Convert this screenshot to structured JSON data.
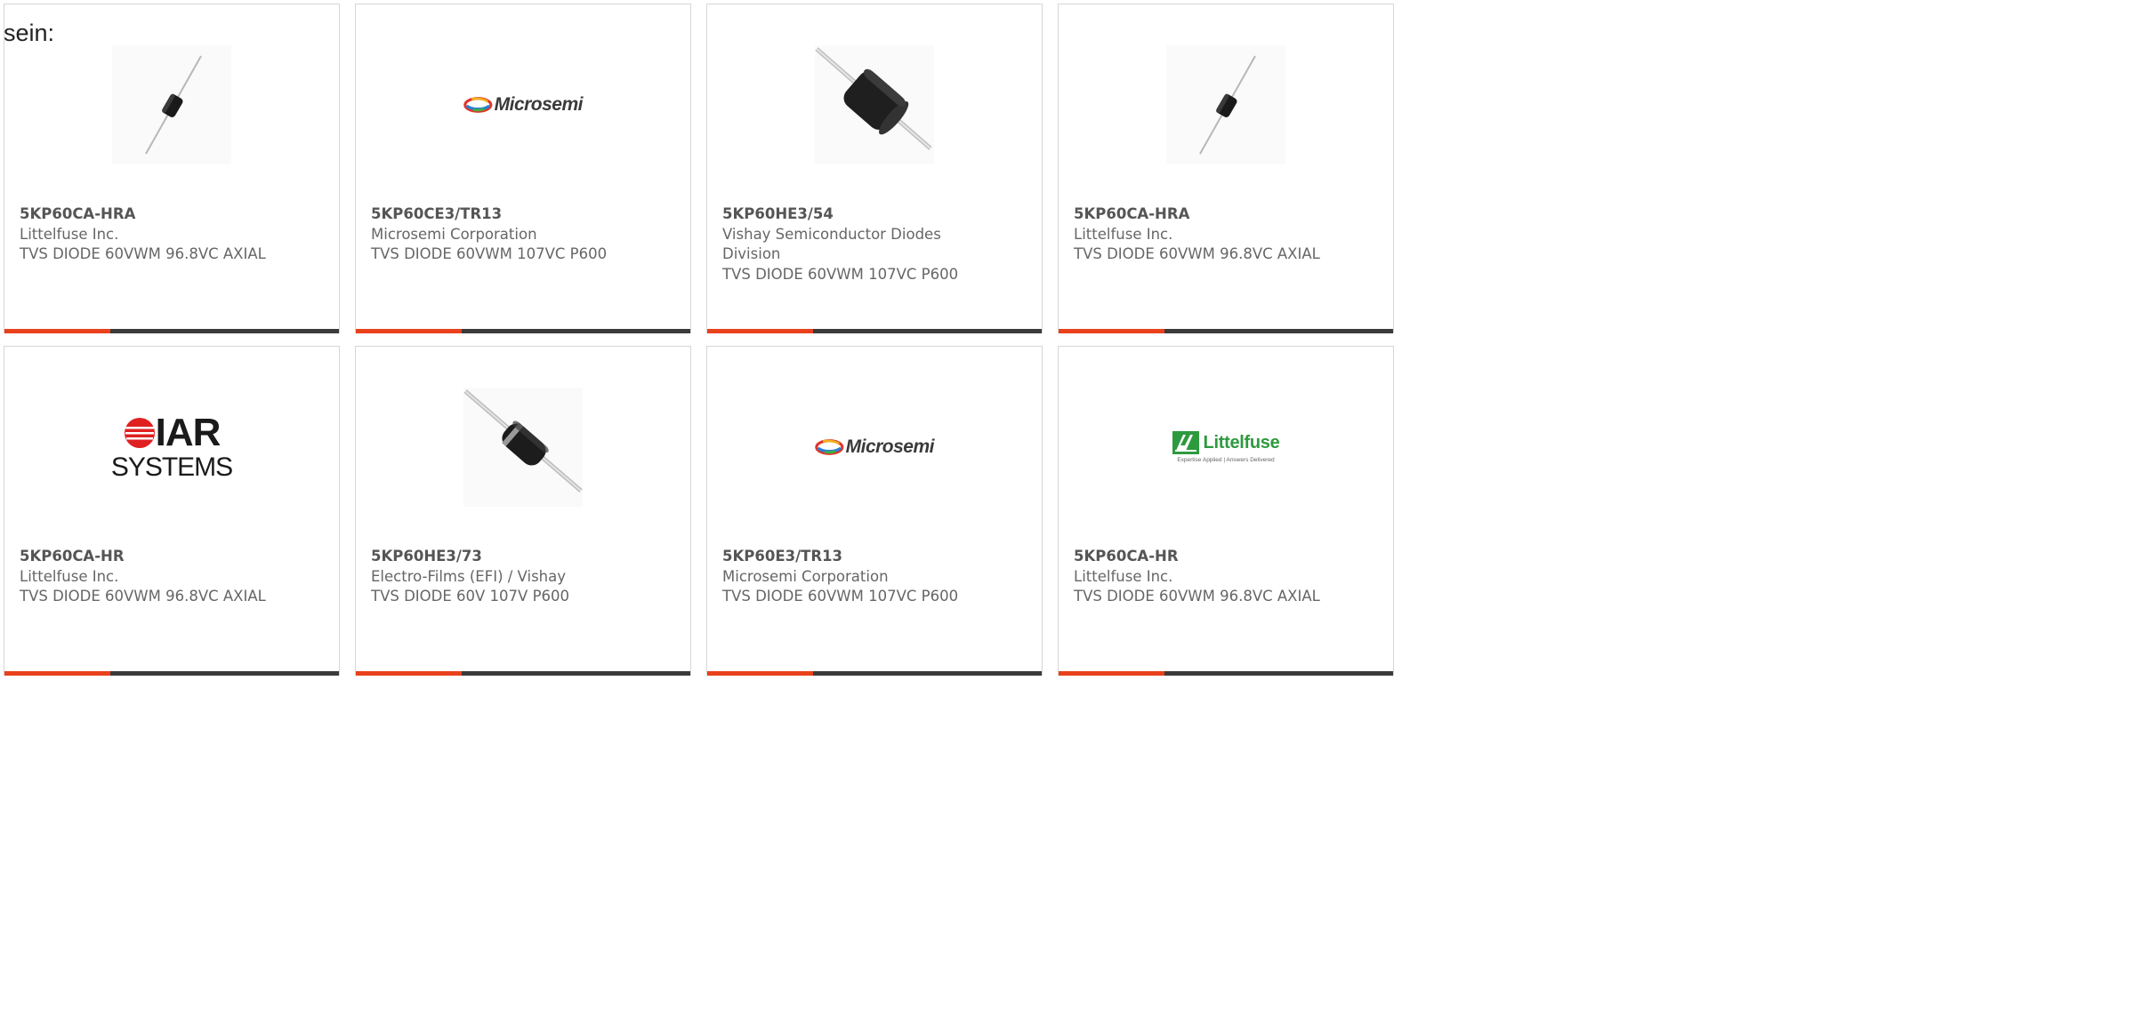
{
  "lead_text": "sein:",
  "accent_color": "#e8411b",
  "bar_color": "#3b3b3b",
  "logos": {
    "microsemi": "Microsemi",
    "iar_top": "IAR",
    "iar_bottom": "SYSTEMS",
    "littelfuse": "Littelfuse",
    "littelfuse_tagline": "Expertise Applied | Answers Delivered"
  },
  "products": [
    {
      "part_number": "5KP60CA-HRA",
      "manufacturer": "Littelfuse Inc.",
      "description": "TVS DIODE 60VWM 96.8VC AXIAL",
      "image": "small-axial-diode-image"
    },
    {
      "part_number": "5KP60CE3/TR13",
      "manufacturer": "Microsemi Corporation",
      "description": "TVS DIODE 60VWM 107VC P600",
      "image": "microsemi-logo"
    },
    {
      "part_number": "5KP60HE3/54",
      "manufacturer": "Vishay Semiconductor Diodes Division",
      "description": "TVS DIODE 60VWM 107VC P600",
      "image": "large-axial-diode-image"
    },
    {
      "part_number": "5KP60CA-HRA",
      "manufacturer": "Littelfuse Inc.",
      "description": "TVS DIODE 60VWM 96.8VC AXIAL",
      "image": "small-axial-diode-image"
    },
    {
      "part_number": "5KP60CA-HR",
      "manufacturer": "Littelfuse Inc.",
      "description": "TVS DIODE 60VWM 96.8VC AXIAL",
      "image": "iar-systems-logo"
    },
    {
      "part_number": "5KP60HE3/73",
      "manufacturer": "Electro-Films (EFI) / Vishay",
      "description": "TVS DIODE 60V 107V P600",
      "image": "banded-axial-diode-image"
    },
    {
      "part_number": "5KP60E3/TR13",
      "manufacturer": "Microsemi Corporation",
      "description": "TVS DIODE 60VWM 107VC P600",
      "image": "microsemi-logo"
    },
    {
      "part_number": "5KP60CA-HR",
      "manufacturer": "Littelfuse Inc.",
      "description": "TVS DIODE 60VWM 96.8VC AXIAL",
      "image": "littelfuse-logo"
    }
  ]
}
